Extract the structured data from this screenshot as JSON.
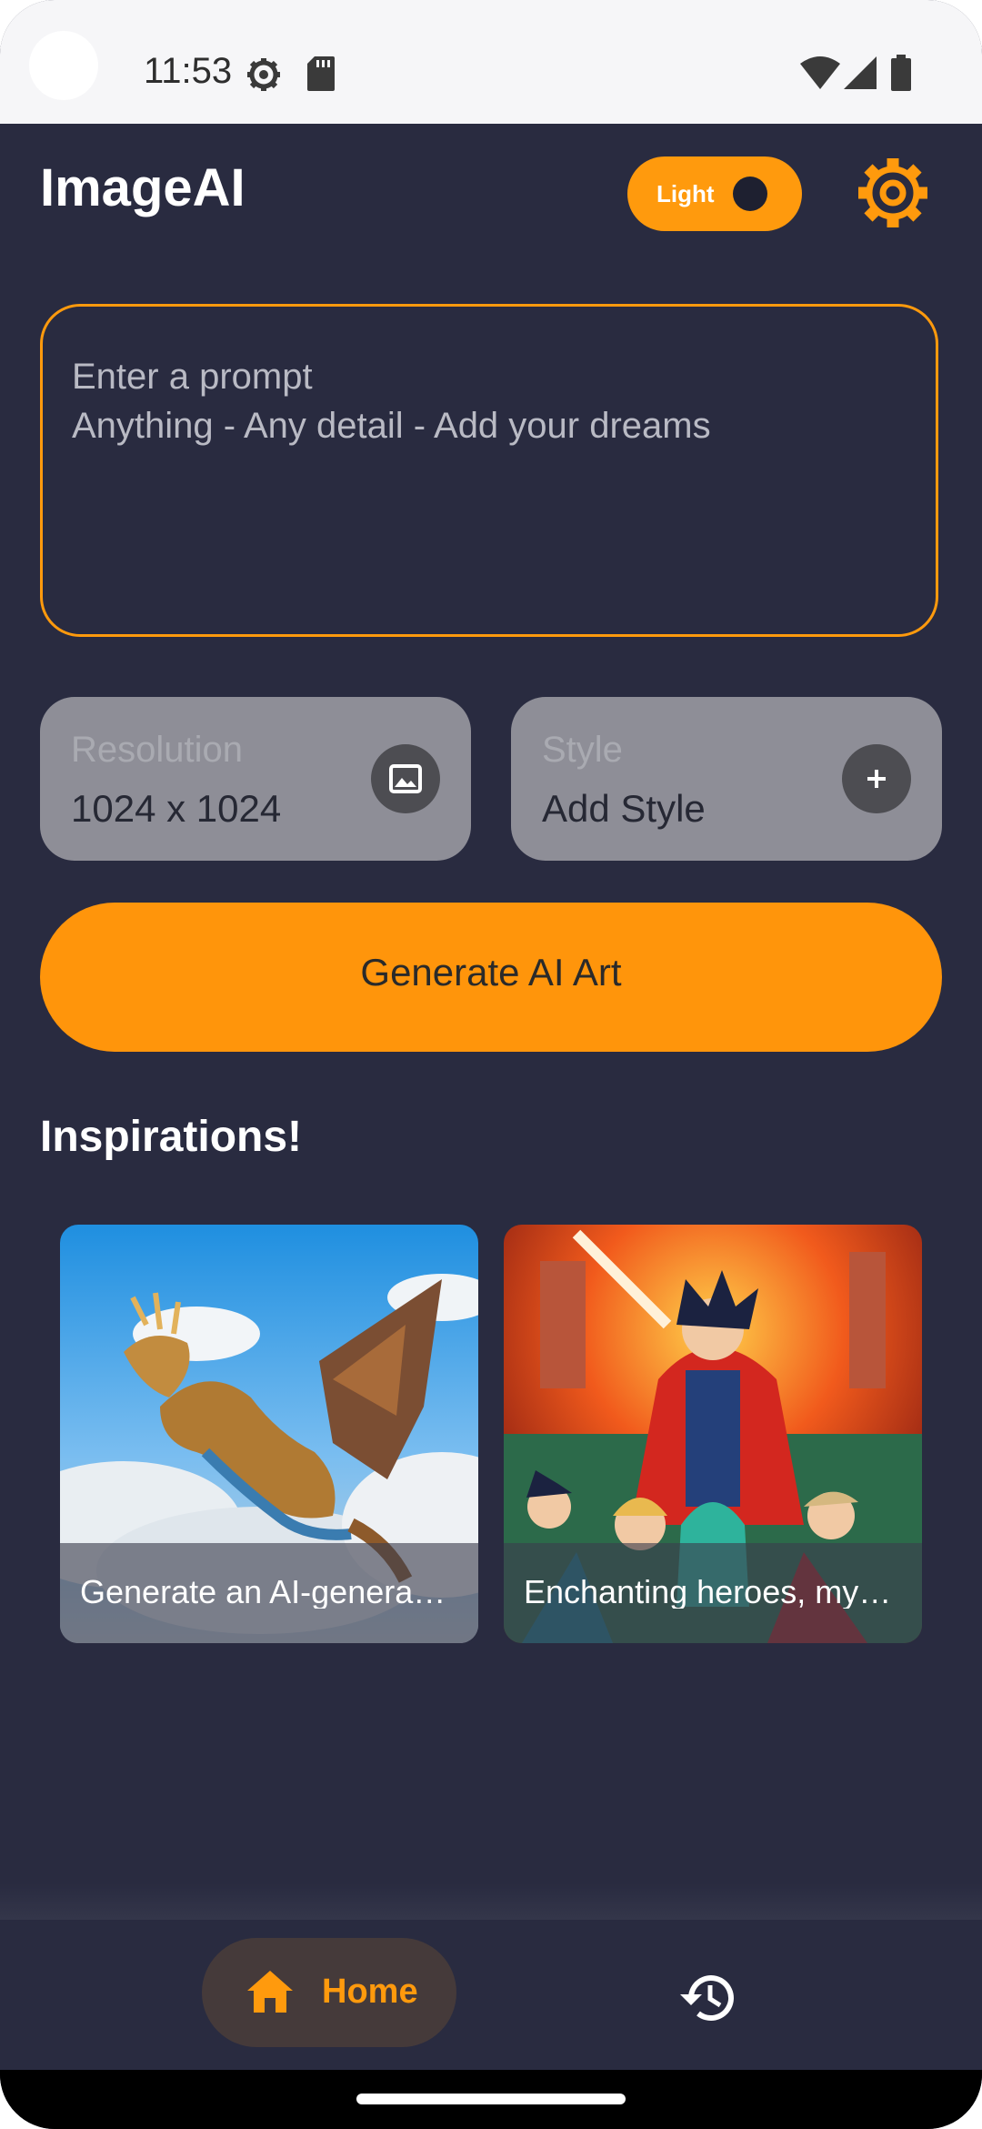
{
  "status_bar": {
    "time": "11:53",
    "icons": [
      "settings-gear-status-icon",
      "sd-card-icon",
      "wifi-icon",
      "cellular-signal-icon",
      "battery-icon"
    ]
  },
  "header": {
    "title": "ImageAI",
    "theme_toggle_label": "Light",
    "settings_icon": "gear-icon"
  },
  "prompt": {
    "placeholder": "Enter a prompt\nAnything - Any detail - Add your dreams"
  },
  "options": {
    "resolution": {
      "label": "Resolution",
      "value": "1024 x 1024",
      "icon": "image-icon"
    },
    "style": {
      "label": "Style",
      "value": "Add Style",
      "icon": "plus-icon"
    }
  },
  "generate_button": {
    "label": "Generate AI Art"
  },
  "inspirations": {
    "title": "Inspirations!",
    "items": [
      {
        "caption": "Generate an AI-genera…",
        "image": "dragon-in-clouds"
      },
      {
        "caption": "Enchanting heroes, my…",
        "image": "anime-heroes"
      }
    ]
  },
  "bottom_nav": {
    "home_label": "Home",
    "home_icon": "home-icon",
    "history_icon": "history-icon"
  },
  "colors": {
    "background": "#292b40",
    "accent": "#ff9a0d",
    "card_gray": "#8e8e97"
  }
}
